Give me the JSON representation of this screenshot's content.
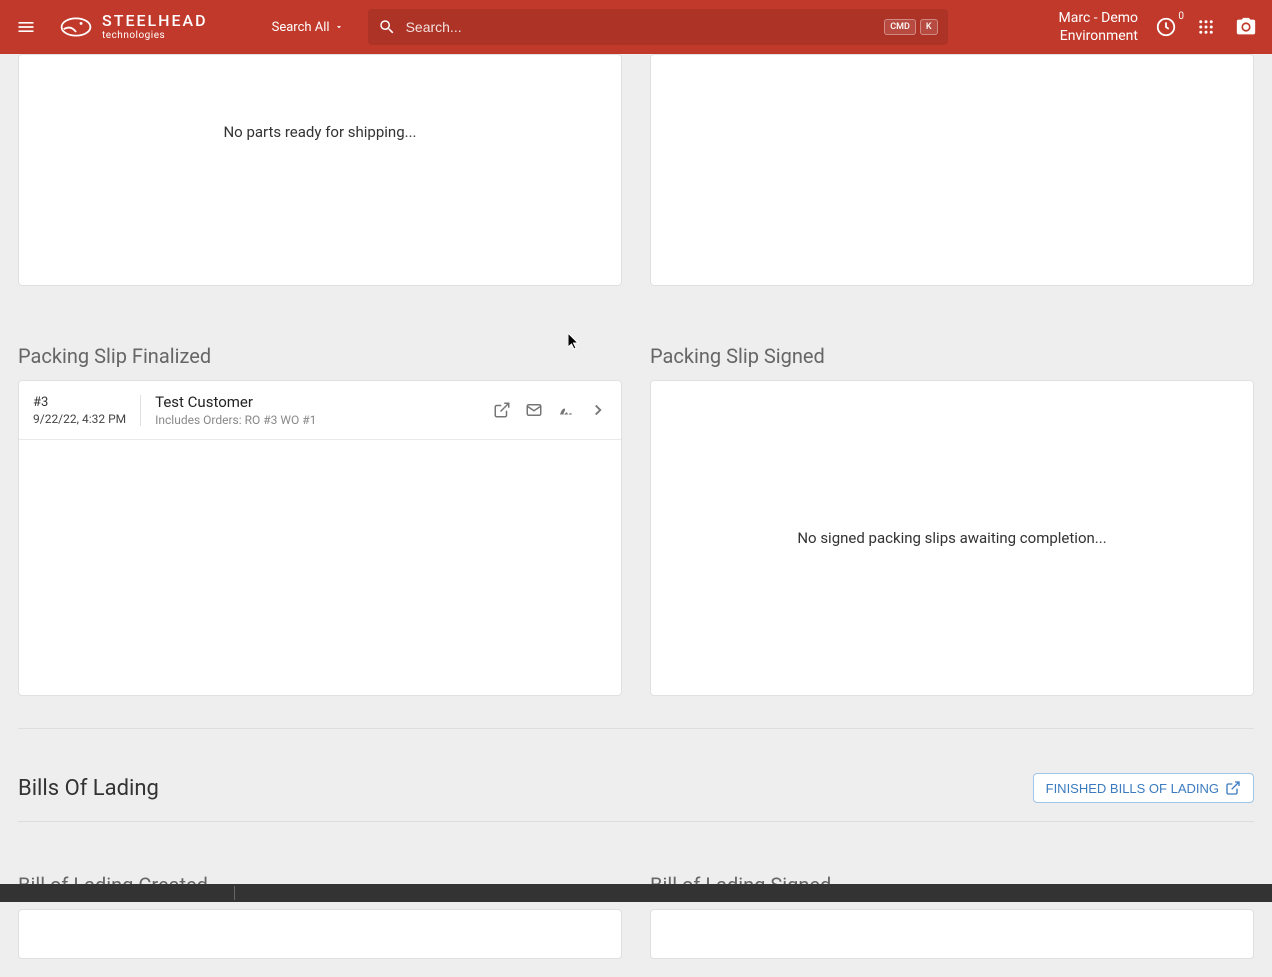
{
  "header": {
    "logo": {
      "main": "STEELHEAD",
      "sub": "technologies"
    },
    "searchFilter": "Search All",
    "searchPlaceholder": "Search...",
    "kbd1": "CMD",
    "kbd2": "K",
    "userName": "Marc - Demo",
    "userEnv": "Environment",
    "badgeCount": "0"
  },
  "panels": {
    "readyEmpty": "No parts ready for shipping...",
    "finalizedTitle": "Packing Slip Finalized",
    "signedTitle": "Packing Slip Signed",
    "signedEmpty": "No signed packing slips awaiting completion..."
  },
  "slip": {
    "num": "#3",
    "date": "9/22/22, 4:32 PM",
    "customer": "Test Customer",
    "detail": "Includes Orders: RO #3 WO #1"
  },
  "bol": {
    "sectionTitle": "Bills Of Lading",
    "buttonLabel": "FINISHED BILLS OF LADING",
    "createdTitle": "Bill of Lading Created",
    "signedTitle": "Bill of Lading Signed"
  }
}
